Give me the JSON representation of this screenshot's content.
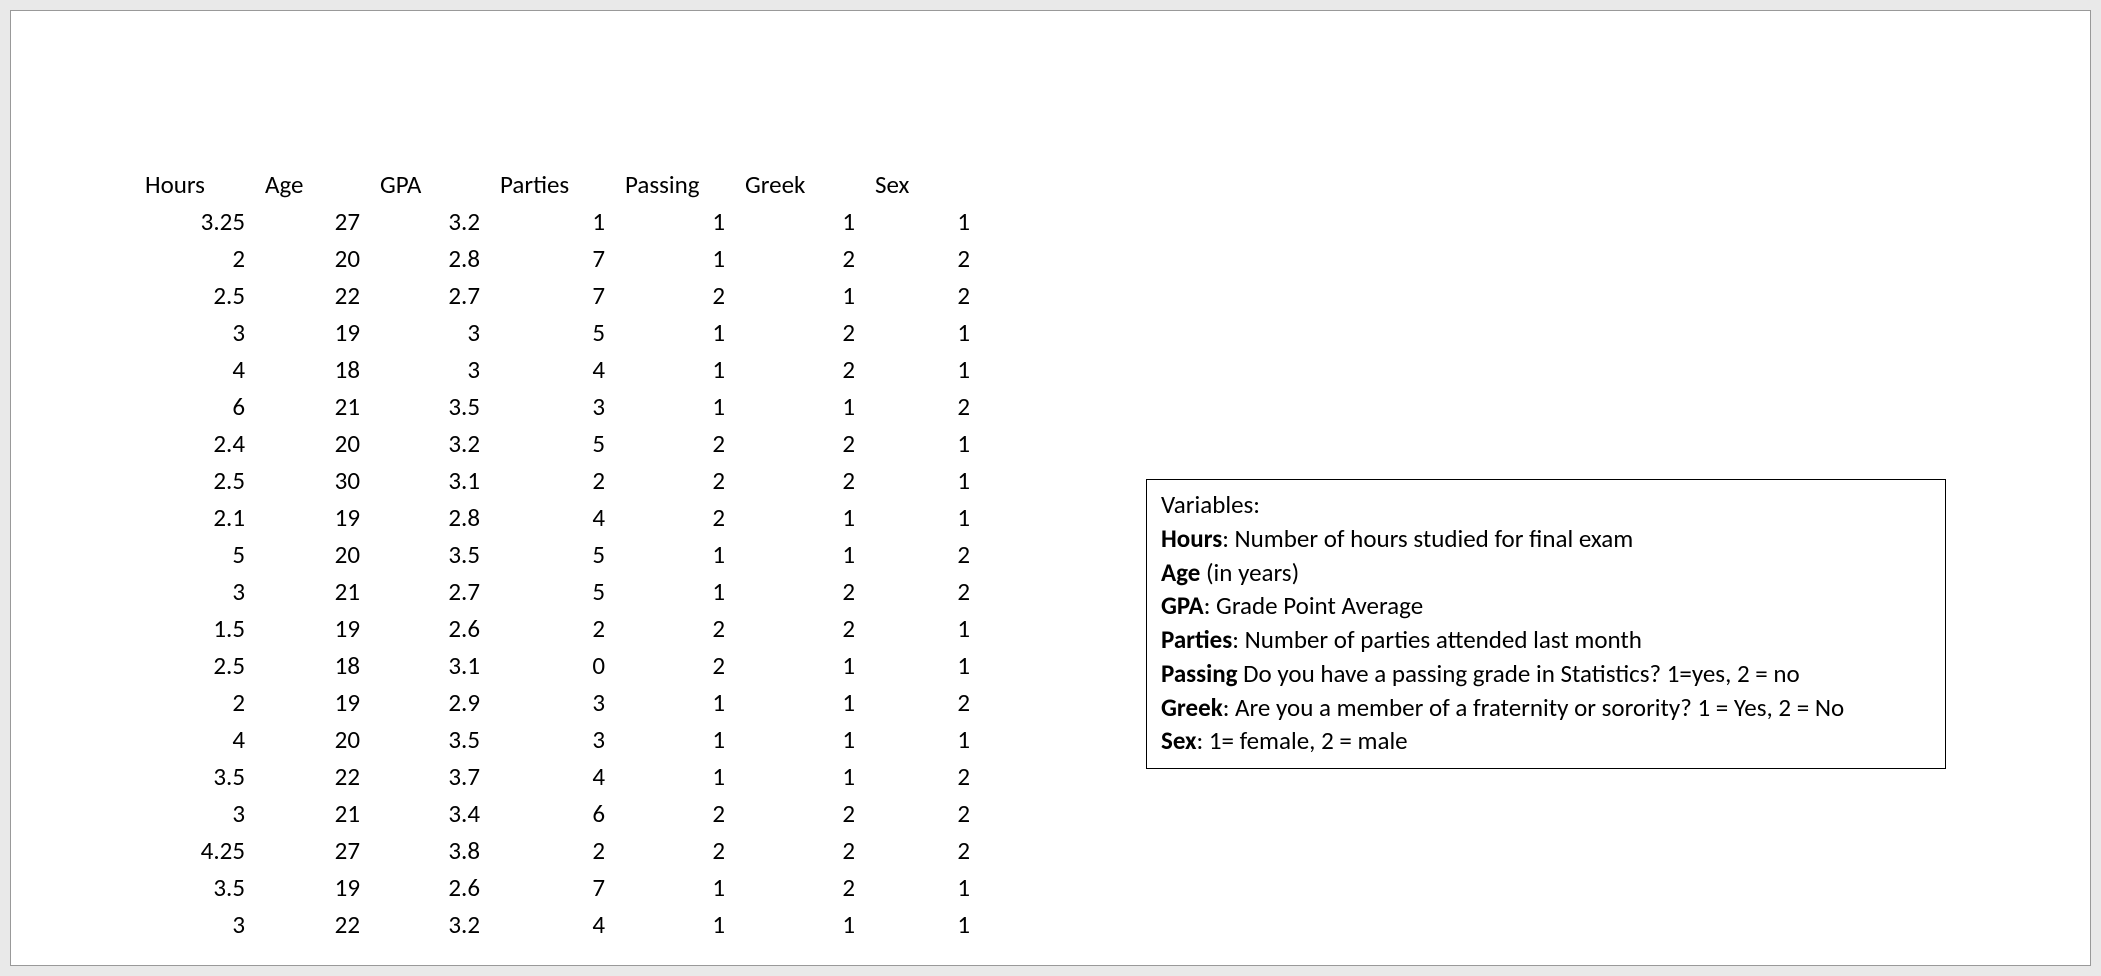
{
  "headers": {
    "hours": "Hours",
    "age": "Age",
    "gpa": "GPA",
    "parties": "Parties",
    "passing": "Passing",
    "greek": "Greek",
    "sex": "Sex"
  },
  "rows": [
    {
      "hours": "3.25",
      "age": "27",
      "gpa": "3.2",
      "parties": "1",
      "passing": "1",
      "greek": "1",
      "sex": "1"
    },
    {
      "hours": "2",
      "age": "20",
      "gpa": "2.8",
      "parties": "7",
      "passing": "1",
      "greek": "2",
      "sex": "2"
    },
    {
      "hours": "2.5",
      "age": "22",
      "gpa": "2.7",
      "parties": "7",
      "passing": "2",
      "greek": "1",
      "sex": "2"
    },
    {
      "hours": "3",
      "age": "19",
      "gpa": "3",
      "parties": "5",
      "passing": "1",
      "greek": "2",
      "sex": "1"
    },
    {
      "hours": "4",
      "age": "18",
      "gpa": "3",
      "parties": "4",
      "passing": "1",
      "greek": "2",
      "sex": "1"
    },
    {
      "hours": "6",
      "age": "21",
      "gpa": "3.5",
      "parties": "3",
      "passing": "1",
      "greek": "1",
      "sex": "2"
    },
    {
      "hours": "2.4",
      "age": "20",
      "gpa": "3.2",
      "parties": "5",
      "passing": "2",
      "greek": "2",
      "sex": "1"
    },
    {
      "hours": "2.5",
      "age": "30",
      "gpa": "3.1",
      "parties": "2",
      "passing": "2",
      "greek": "2",
      "sex": "1"
    },
    {
      "hours": "2.1",
      "age": "19",
      "gpa": "2.8",
      "parties": "4",
      "passing": "2",
      "greek": "1",
      "sex": "1"
    },
    {
      "hours": "5",
      "age": "20",
      "gpa": "3.5",
      "parties": "5",
      "passing": "1",
      "greek": "1",
      "sex": "2"
    },
    {
      "hours": "3",
      "age": "21",
      "gpa": "2.7",
      "parties": "5",
      "passing": "1",
      "greek": "2",
      "sex": "2"
    },
    {
      "hours": "1.5",
      "age": "19",
      "gpa": "2.6",
      "parties": "2",
      "passing": "2",
      "greek": "2",
      "sex": "1"
    },
    {
      "hours": "2.5",
      "age": "18",
      "gpa": "3.1",
      "parties": "0",
      "passing": "2",
      "greek": "1",
      "sex": "1"
    },
    {
      "hours": "2",
      "age": "19",
      "gpa": "2.9",
      "parties": "3",
      "passing": "1",
      "greek": "1",
      "sex": "2"
    },
    {
      "hours": "4",
      "age": "20",
      "gpa": "3.5",
      "parties": "3",
      "passing": "1",
      "greek": "1",
      "sex": "1"
    },
    {
      "hours": "3.5",
      "age": "22",
      "gpa": "3.7",
      "parties": "4",
      "passing": "1",
      "greek": "1",
      "sex": "2"
    },
    {
      "hours": "3",
      "age": "21",
      "gpa": "3.4",
      "parties": "6",
      "passing": "2",
      "greek": "2",
      "sex": "2"
    },
    {
      "hours": "4.25",
      "age": "27",
      "gpa": "3.8",
      "parties": "2",
      "passing": "2",
      "greek": "2",
      "sex": "2"
    },
    {
      "hours": "3.5",
      "age": "19",
      "gpa": "2.6",
      "parties": "7",
      "passing": "1",
      "greek": "2",
      "sex": "1"
    },
    {
      "hours": "3",
      "age": "22",
      "gpa": "3.2",
      "parties": "4",
      "passing": "1",
      "greek": "1",
      "sex": "1"
    }
  ],
  "legend": {
    "title": "Variables:",
    "hours_b": "Hours",
    "hours_t": ": Number of hours studied for final exam",
    "age_b": "Age",
    "age_t": " (in years)",
    "gpa_b": "GPA",
    "gpa_t": ": Grade Point Average",
    "parties_b": "Parties",
    "parties_t": ": Number of parties attended last month",
    "passing_b": "Passing",
    "passing_t": " Do you have a passing grade in Statistics? 1=yes, 2 = no",
    "greek_b": "Greek",
    "greek_t": ": Are you a member of a fraternity or sorority? 1 = Yes, 2 = No",
    "sex_b": "Sex",
    "sex_t": ": 1= female, 2 = male"
  }
}
